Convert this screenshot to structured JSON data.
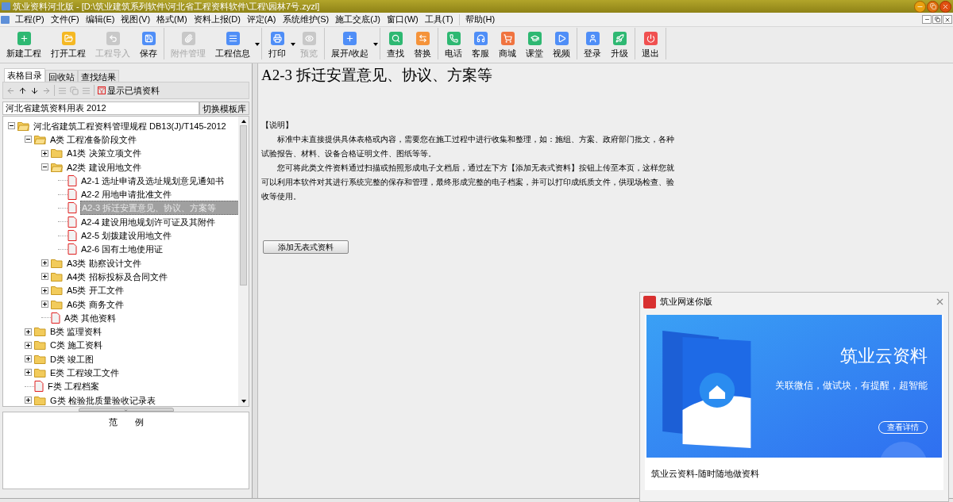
{
  "window": {
    "title": "筑业资料河北版 - [D:\\筑业建筑系列软件\\河北省工程资料软件\\工程\\园林7号.zyzl]"
  },
  "menu": [
    "工程(P)",
    "文件(F)",
    "编辑(E)",
    "视图(V)",
    "格式(M)",
    "资料上报(D)",
    "评定(A)",
    "系统维护(S)",
    "施工交底(J)",
    "窗口(W)",
    "工具(T)",
    "帮助(H)"
  ],
  "toolbar": [
    [
      {
        "label": "新建工程",
        "disabled": false,
        "dropdown": false,
        "color": "#2eb872"
      },
      {
        "label": "打开工程",
        "disabled": false,
        "dropdown": false,
        "color": "#f5b823"
      },
      {
        "label": "工程导入",
        "disabled": true,
        "dropdown": false,
        "color": "#c8c8c8"
      },
      {
        "label": "保存",
        "disabled": false,
        "dropdown": false,
        "color": "#4f8ef7"
      }
    ],
    [
      {
        "label": "附件管理",
        "disabled": true,
        "dropdown": false,
        "color": "#c8c8c8"
      },
      {
        "label": "工程信息",
        "disabled": false,
        "dropdown": true,
        "color": "#4f8ef7"
      }
    ],
    [
      {
        "label": "打印",
        "disabled": false,
        "dropdown": true,
        "color": "#4f8ef7"
      },
      {
        "label": "预览",
        "disabled": true,
        "dropdown": false,
        "color": "#c8c8c8"
      }
    ],
    [
      {
        "label": "展开/收起",
        "disabled": false,
        "dropdown": true,
        "color": "#4f8ef7"
      }
    ],
    [
      {
        "label": "查找",
        "disabled": false,
        "dropdown": false,
        "color": "#2eb872"
      },
      {
        "label": "替换",
        "disabled": false,
        "dropdown": false,
        "color": "#f5933a"
      }
    ],
    [
      {
        "label": "电话",
        "disabled": false,
        "dropdown": false,
        "color": "#2eb872"
      },
      {
        "label": "客服",
        "disabled": false,
        "dropdown": false,
        "color": "#4f8ef7"
      },
      {
        "label": "商城",
        "disabled": false,
        "dropdown": false,
        "color": "#f07440"
      },
      {
        "label": "课堂",
        "disabled": false,
        "dropdown": false,
        "color": "#2eb872"
      },
      {
        "label": "视频",
        "disabled": false,
        "dropdown": false,
        "color": "#4f8ef7"
      }
    ],
    [
      {
        "label": "登录",
        "disabled": false,
        "dropdown": false,
        "color": "#4f8ef7"
      },
      {
        "label": "升级",
        "disabled": false,
        "dropdown": false,
        "color": "#2eb872"
      }
    ],
    [
      {
        "label": "退出",
        "disabled": false,
        "dropdown": false,
        "color": "#f05050"
      }
    ]
  ],
  "sidebar": {
    "tabs": [
      {
        "label": "表格目录",
        "selected": true
      },
      {
        "label": "回收站",
        "selected": false
      },
      {
        "label": "查找结果",
        "selected": false
      }
    ],
    "filter_button": "显示已填资料",
    "library": {
      "value": "河北省建筑资料用表 2012",
      "button": "切换模板库"
    },
    "tree": [
      {
        "label": "河北省建筑工程资料管理规程 DB13(J)/T145-2012",
        "kind": "folder",
        "expanded": true,
        "selected": false,
        "children": [
          {
            "label": "A类 工程准备阶段文件",
            "kind": "folder",
            "expanded": true,
            "selected": false,
            "children": [
              {
                "label": "A1类 决策立项文件",
                "kind": "folder",
                "expanded": false,
                "selected": false
              },
              {
                "label": "A2类 建设用地文件",
                "kind": "folder",
                "expanded": true,
                "selected": false,
                "children": [
                  {
                    "label": "A2-1 选址申请及选址规划意见通知书",
                    "kind": "document",
                    "selected": false
                  },
                  {
                    "label": "A2-2 用地申请批准文件",
                    "kind": "document",
                    "selected": false
                  },
                  {
                    "label": "A2-3 拆迁安置意见、协议、方案等",
                    "kind": "document",
                    "selected": true
                  },
                  {
                    "label": "A2-4 建设用地规划许可证及其附件",
                    "kind": "document",
                    "selected": false
                  },
                  {
                    "label": "A2-5 划拨建设用地文件",
                    "kind": "document",
                    "selected": false
                  },
                  {
                    "label": "A2-6 国有土地使用证",
                    "kind": "document",
                    "selected": false
                  }
                ]
              },
              {
                "label": "A3类 勘察设计文件",
                "kind": "folder",
                "expanded": false,
                "selected": false
              },
              {
                "label": "A4类 招标投标及合同文件",
                "kind": "folder",
                "expanded": false,
                "selected": false
              },
              {
                "label": "A5类 开工文件",
                "kind": "folder",
                "expanded": false,
                "selected": false
              },
              {
                "label": "A6类 商务文件",
                "kind": "folder",
                "expanded": false,
                "selected": false
              },
              {
                "label": "A类 其他资料",
                "kind": "document",
                "selected": false
              }
            ]
          },
          {
            "label": "B类 监理资料",
            "kind": "folder",
            "expanded": false,
            "selected": false
          },
          {
            "label": "C类 施工资料",
            "kind": "folder",
            "expanded": false,
            "selected": false
          },
          {
            "label": "D类 竣工图",
            "kind": "folder",
            "expanded": false,
            "selected": false
          },
          {
            "label": "E类 工程竣工文件",
            "kind": "folder",
            "expanded": false,
            "selected": false
          },
          {
            "label": "F类 工程档案",
            "kind": "document",
            "selected": false
          },
          {
            "label": "G类 检验批质量验收记录表",
            "kind": "folder",
            "expanded": false,
            "selected": false
          }
        ]
      }
    ],
    "example_panel": {
      "title": "范　　例"
    }
  },
  "document": {
    "title": "A2-3 拆迁安置意见、协议、方案等",
    "note_heading": "【说明】",
    "paragraphs": [
      "标准中未直接提供具体表格或内容，需要您在施工过程中进行收集和整理，如：施组、方案、政府部门批文，各种试验报告、材料、设备合格证明文件、图纸等等。",
      "您可将此类文件资料通过扫描或拍照形成电子文档后，通过左下方【添加无表式资料】按钮上传至本页，这样您就可以利用本软件对其进行系统完整的保存和管理，最终形成完整的电子档案，并可以打印成纸质文件，供现场检查、验收等使用。"
    ],
    "add_button": "添加无表式资料"
  },
  "popup": {
    "title": "筑业网迷你版",
    "banner": {
      "headline": "筑业云资料",
      "tagline": "关联微信，做试块，有提醒，超智能",
      "button": "查看详情"
    },
    "caption": "筑业云资料-随时随地做资料"
  }
}
